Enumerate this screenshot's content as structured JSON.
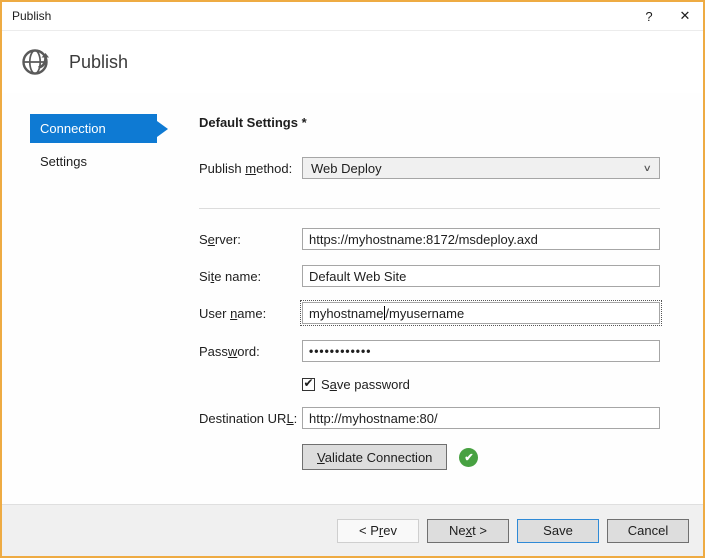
{
  "window": {
    "title": "Publish",
    "help_label": "?",
    "close_label": "✕"
  },
  "header": {
    "title": "Publish"
  },
  "sidebar": {
    "items": [
      {
        "label": "Connection",
        "selected": true
      },
      {
        "label": "Settings",
        "selected": false
      }
    ]
  },
  "form": {
    "heading": "Default Settings *",
    "publish_method": {
      "label_pre": "Publish ",
      "label_mnemonic": "m",
      "label_post": "ethod:",
      "value": "Web Deploy"
    },
    "server": {
      "label_pre": "S",
      "label_mnemonic": "e",
      "label_post": "rver:",
      "value": "https://myhostname:8172/msdeploy.axd"
    },
    "site_name": {
      "label_pre": "Si",
      "label_mnemonic": "t",
      "label_post": "e name:",
      "value": "Default Web Site"
    },
    "user_name": {
      "label_pre": "User ",
      "label_mnemonic": "n",
      "label_post": "ame:",
      "value": "myhostname/myusername",
      "value_before_caret": "myhostname",
      "value_after_caret": "/myusername",
      "focused": true
    },
    "password": {
      "label_pre": "Pass",
      "label_mnemonic": "w",
      "label_post": "ord:",
      "masked_value": "••••••••••••"
    },
    "save_password": {
      "label_pre": "S",
      "label_mnemonic": "a",
      "label_post": "ve password",
      "checked": true,
      "check_glyph": "✔"
    },
    "destination_url": {
      "label_pre": "Destination UR",
      "label_mnemonic": "L",
      "label_post": ":",
      "value": "http://myhostname:80/"
    },
    "validate": {
      "label_pre": "",
      "label_mnemonic": "V",
      "label_post": "alidate Connection",
      "status": "success",
      "status_glyph": "✔"
    }
  },
  "footer": {
    "buttons": [
      {
        "label_pre": "< P",
        "label_mnemonic": "r",
        "label_post": "ev"
      },
      {
        "label_pre": "Ne",
        "label_mnemonic": "x",
        "label_post": "t >"
      },
      {
        "label_pre": "Save",
        "label_mnemonic": "",
        "label_post": "",
        "default": true
      },
      {
        "label_pre": "Cancel",
        "label_mnemonic": "",
        "label_post": ""
      }
    ]
  },
  "colors": {
    "window_border": "#eeab43",
    "selection_blue": "#0e7ad3",
    "default_button_border": "#2f8ad6",
    "success_green": "#47a141",
    "footer_bg": "#f0f0f0"
  }
}
